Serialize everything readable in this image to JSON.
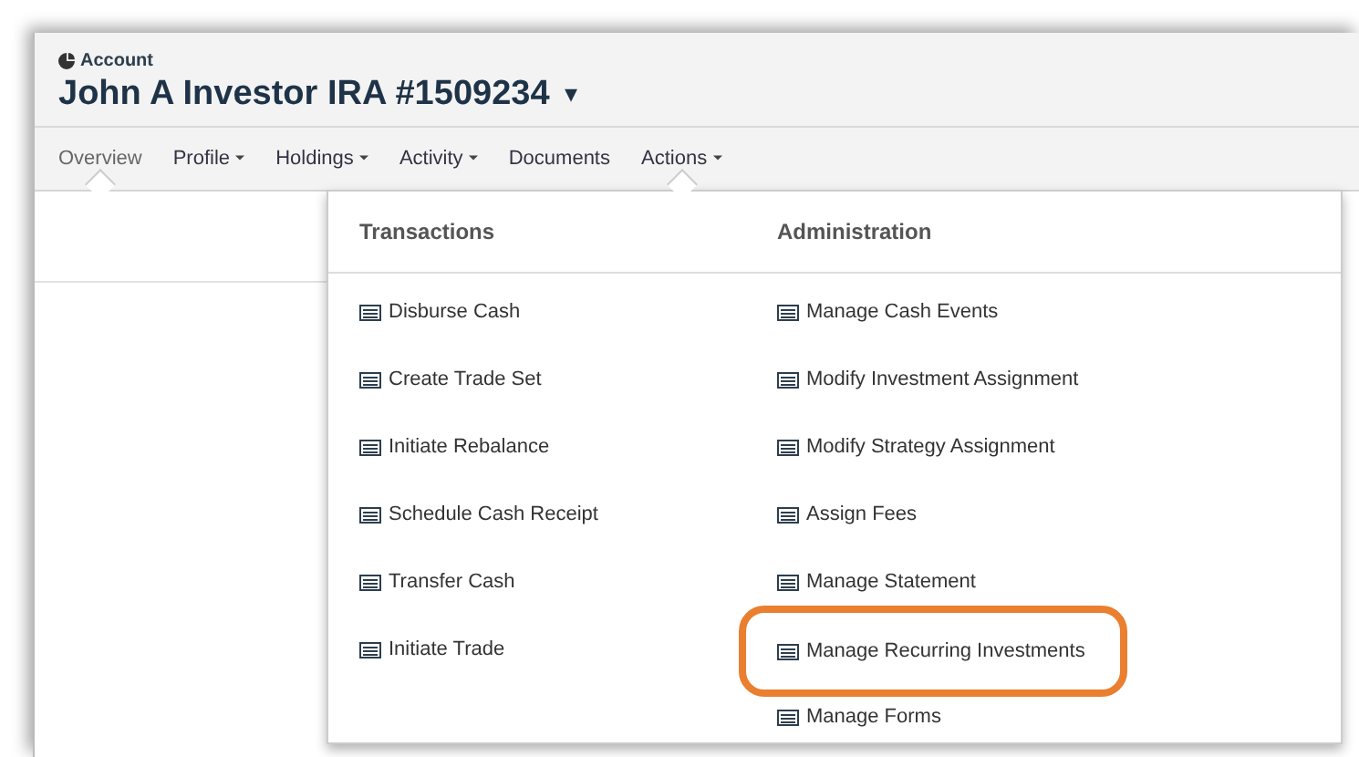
{
  "header": {
    "label": "Account",
    "title": "John A Investor IRA #1509234",
    "title_caret": "▾"
  },
  "nav": [
    {
      "label": "Overview",
      "has_menu": false,
      "selected": true,
      "expanded": false
    },
    {
      "label": "Profile",
      "has_menu": true,
      "selected": false,
      "expanded": false
    },
    {
      "label": "Holdings",
      "has_menu": true,
      "selected": false,
      "expanded": false
    },
    {
      "label": "Activity",
      "has_menu": true,
      "selected": false,
      "expanded": false
    },
    {
      "label": "Documents",
      "has_menu": false,
      "selected": false,
      "expanded": false
    },
    {
      "label": "Actions",
      "has_menu": true,
      "selected": false,
      "expanded": true
    }
  ],
  "menu": {
    "columns": [
      {
        "heading": "Transactions",
        "items": [
          {
            "label": "Disburse Cash",
            "highlighted": false
          },
          {
            "label": "Create Trade Set",
            "highlighted": false
          },
          {
            "label": "Initiate Rebalance",
            "highlighted": false
          },
          {
            "label": "Schedule Cash Receipt",
            "highlighted": false
          },
          {
            "label": "Transfer Cash",
            "highlighted": false
          },
          {
            "label": "Initiate Trade",
            "highlighted": false
          }
        ]
      },
      {
        "heading": "Administration",
        "items": [
          {
            "label": "Manage Cash Events",
            "highlighted": false
          },
          {
            "label": "Modify Investment Assignment",
            "highlighted": false
          },
          {
            "label": "Modify Strategy Assignment",
            "highlighted": false
          },
          {
            "label": "Assign Fees",
            "highlighted": false
          },
          {
            "label": "Manage Statement",
            "highlighted": false
          },
          {
            "label": "Manage Recurring Investments",
            "highlighted": true
          },
          {
            "label": "Manage Forms",
            "highlighted": false
          }
        ]
      }
    ]
  }
}
